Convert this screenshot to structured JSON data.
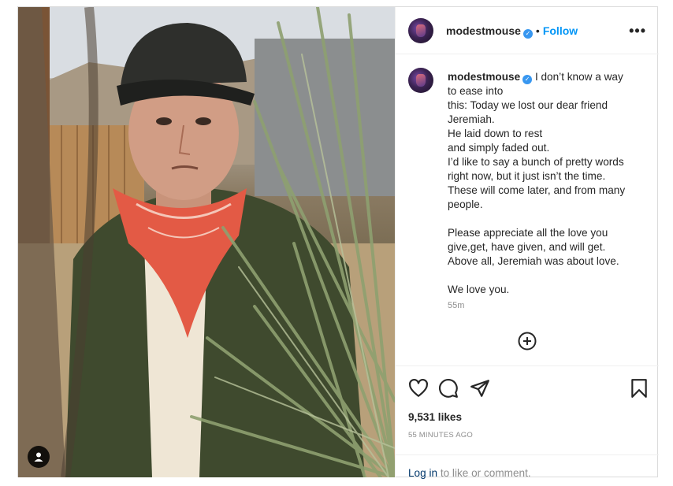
{
  "post": {
    "username": "modestmouse",
    "verified_glyph": "✓",
    "separator": "•",
    "follow_label": "Follow",
    "more_label": "•••",
    "caption": "I don’t know a way\nto ease into\nthis: Today we lost our dear friend\nJeremiah.\nHe laid down to rest\nand simply faded out.\nI’d like to say a bunch of pretty words\nright now, but it just isn’t the time.\nThese will come later, and from many\npeople.\n\nPlease appreciate all the love you\ngive,get, have given, and will get.\nAbove all, Jeremiah was about love.\n\nWe love you.",
    "time_ago": "55m",
    "likes": "9,531 likes",
    "date": "55 MINUTES AGO",
    "login_link": "Log in",
    "comment_prompt": " to like or comment."
  },
  "icons": {
    "more": "more-options-icon",
    "plus": "plus-circle-icon",
    "like": "heart-icon",
    "comment": "comment-icon",
    "share": "share-icon",
    "save": "bookmark-icon",
    "tag": "user-tag-icon",
    "verified": "verified-badge-icon"
  },
  "colors": {
    "accent": "#0095f6",
    "verified": "#3897f0",
    "text": "#262626",
    "muted": "#8e8e8e",
    "border": "#dbdbdb",
    "link": "#00376b"
  }
}
